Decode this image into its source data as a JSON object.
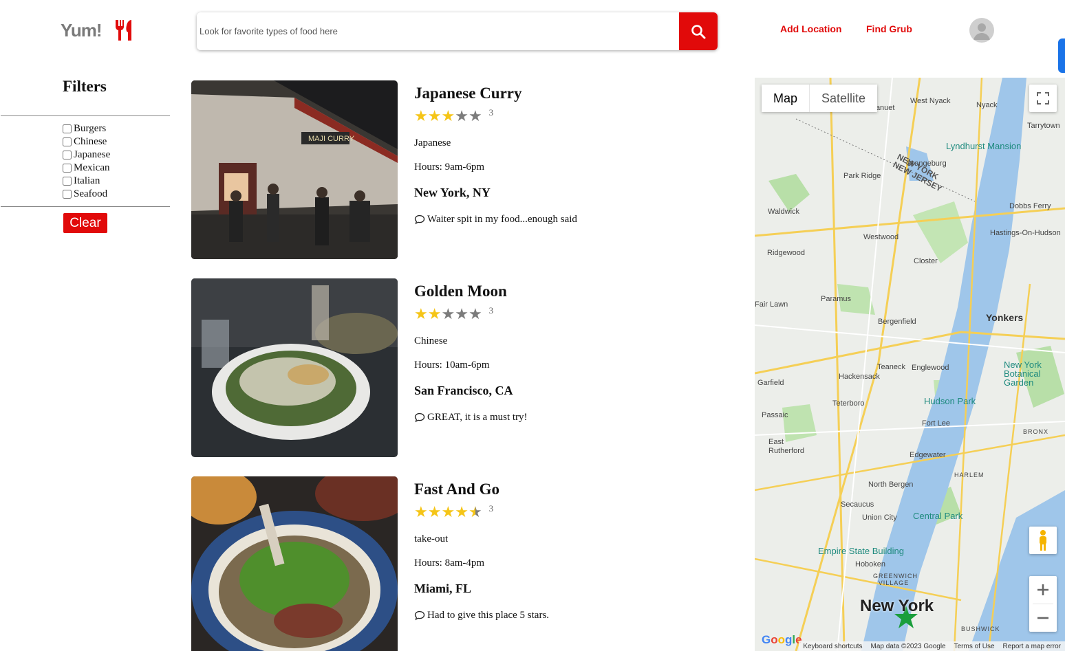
{
  "header": {
    "logo_text": "Yum!",
    "logo_icon": "utensils-icon",
    "search_placeholder": "Look for favorite types of food here",
    "search_icon": "search-icon",
    "nav": {
      "add_location": "Add Location",
      "find_grub": "Find Grub"
    },
    "avatar_icon": "user-avatar-icon",
    "accent_color": "#e10a0a"
  },
  "filters": {
    "title": "Filters",
    "options": [
      "Burgers",
      "Chinese",
      "Japanese",
      "Mexican",
      "Italian",
      "Seafood"
    ],
    "clear_label": "Clear"
  },
  "restaurants": [
    {
      "name": "Japanese Curry",
      "stars": 3,
      "review_count": "3",
      "cuisine": "Japanese",
      "hours": "Hours: 9am-6pm",
      "location": "New York, NY",
      "review": "Waiter spit in my food...enough said"
    },
    {
      "name": "Golden Moon",
      "stars": 2,
      "review_count": "3",
      "cuisine": "Chinese",
      "hours": "Hours: 10am-6pm",
      "location": "San Francisco, CA",
      "review": "GREAT, it is a must try!"
    },
    {
      "name": "Fast And Go",
      "stars": 4.5,
      "review_count": "3",
      "cuisine": "take-out",
      "hours": "Hours: 8am-4pm",
      "location": "Miami, FL",
      "review": "Had to give this place 5 stars."
    }
  ],
  "map": {
    "type_map": "Map",
    "type_satellite": "Satellite",
    "labels": {
      "new_york": "New York",
      "yonkers": "Yonkers",
      "paramus": "Paramus",
      "hackensack": "Hackensack",
      "passaic": "Passaic",
      "hoboken": "Hoboken",
      "empire_state": "Empire State Building",
      "central_park": "Central Park",
      "hudson_park": "Hudson Park",
      "lyndhurst": "Lyndhurst Mansion",
      "botanical": "New York Botanical Garden",
      "teaneck": "Teaneck",
      "englewood": "Englewood",
      "fort_lee": "Fort Lee",
      "bergenfield": "Bergenfield",
      "union_city": "Union City",
      "north_bergen": "North Bergen",
      "secaucus": "Secaucus",
      "edgewater": "Edgewater",
      "park_ridge": "Park Ridge",
      "westwood": "Westwood",
      "closter": "Closter",
      "ridgewood": "Ridgewood",
      "waldwick": "Waldwick",
      "fair_lawn": "Fair Lawn",
      "garfield": "Garfield",
      "teterboro": "Teterboro",
      "east_rutherford": "East Rutherford",
      "orangeburg": "Orangeburg",
      "nanuet": "Nanuet",
      "west_nyack": "West Nyack",
      "nyack": "Nyack",
      "dobbs_ferry": "Dobbs Ferry",
      "hastings": "Hastings-On-Hudson",
      "tarrytown": "Tarrytown",
      "ny_nj": "NEW YORK NEW JERSEY",
      "harlem": "HARLEM",
      "bronx": "BRONX",
      "greenwich": "GREENWICH VILLAGE",
      "bushwick": "BUSHWICK"
    },
    "footer": {
      "shortcuts": "Keyboard shortcuts",
      "data": "Map data ©2023 Google",
      "terms": "Terms of Use",
      "report": "Report a map error"
    },
    "google_logo": "Google"
  }
}
